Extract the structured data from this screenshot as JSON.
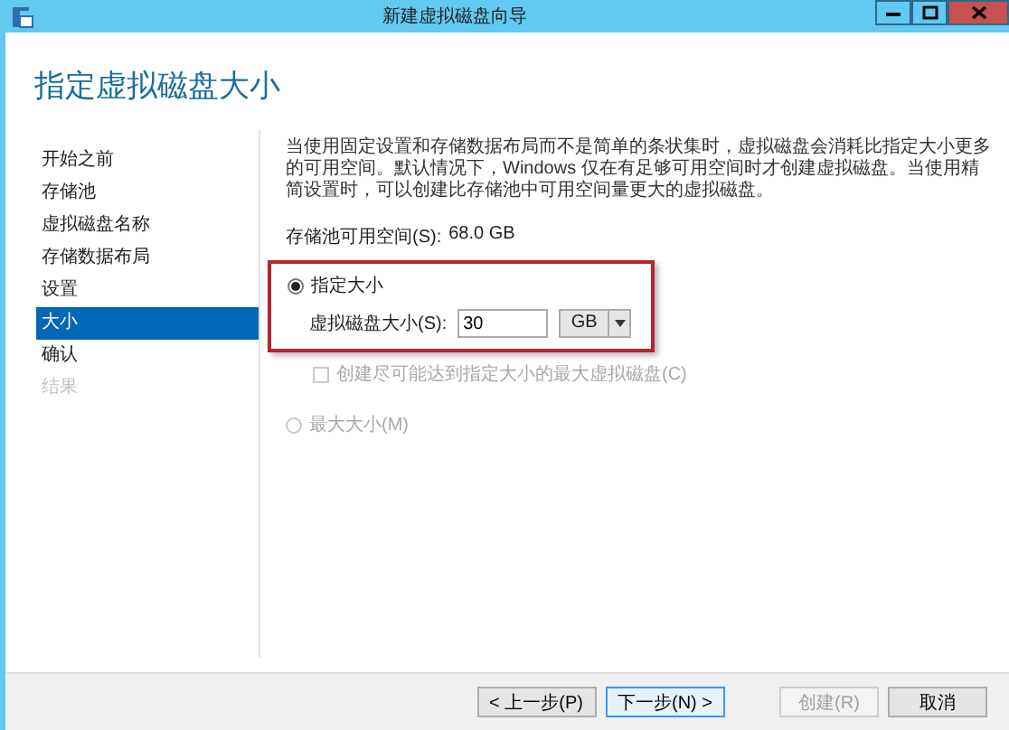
{
  "window": {
    "title": "新建虚拟磁盘向导"
  },
  "header": "指定虚拟磁盘大小",
  "steps": [
    {
      "label": "开始之前",
      "selected": false,
      "disabled": false
    },
    {
      "label": "存储池",
      "selected": false,
      "disabled": false
    },
    {
      "label": "虚拟磁盘名称",
      "selected": false,
      "disabled": false
    },
    {
      "label": "存储数据布局",
      "selected": false,
      "disabled": false
    },
    {
      "label": "设置",
      "selected": false,
      "disabled": false
    },
    {
      "label": "大小",
      "selected": true,
      "disabled": false
    },
    {
      "label": "确认",
      "selected": false,
      "disabled": false
    },
    {
      "label": "结果",
      "selected": false,
      "disabled": true
    }
  ],
  "description": "当使用固定设置和存储数据布局而不是简单的条状集时，虚拟磁盘会消耗比指定大小更多的可用空间。默认情况下，Windows 仅在有足够可用空间时才创建虚拟磁盘。当使用精简设置时，可以创建比存储池中可用空间量更大的虚拟磁盘。",
  "free_space": {
    "label": "存储池可用空间(S):",
    "value": "68.0 GB"
  },
  "size_option": {
    "label": "指定大小",
    "selected": true,
    "highlighted": true,
    "field": {
      "label": "虚拟磁盘大小(S):",
      "value": "30",
      "unit": "GB"
    }
  },
  "max_checkbox": {
    "label": "创建尽可能达到指定大小的最大虚拟磁盘(C)",
    "checked": false,
    "disabled": true
  },
  "max_option": {
    "label": "最大大小(M)",
    "selected": false,
    "disabled": true
  },
  "buttons": [
    {
      "label": "< 上一步(P)",
      "disabled": false,
      "default": false
    },
    {
      "label": "下一步(N) >",
      "disabled": false,
      "default": true
    },
    {
      "label": "创建(R)",
      "disabled": true,
      "default": false
    },
    {
      "label": "取消",
      "disabled": false,
      "default": false
    }
  ]
}
